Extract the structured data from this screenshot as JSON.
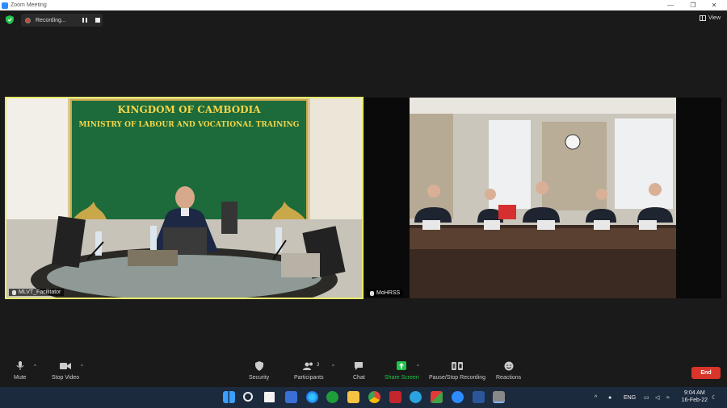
{
  "window": {
    "title": "Zoom Meeting",
    "controls": {
      "minimize": "—",
      "restore": "❐",
      "close": "✕"
    }
  },
  "meeting_bar": {
    "recording_label": "Recording...",
    "view_label": "View"
  },
  "participants_video": [
    {
      "name": "MLVT_Facilitator",
      "banner_line1": "KINGDOM OF CAMBODIA",
      "banner_line2": "MINISTRY OF LABOUR AND VOCATIONAL TRAINING",
      "active_speaker": true
    },
    {
      "name": "MoHRSS",
      "active_speaker": false
    }
  ],
  "toolbar": {
    "mute": "Mute",
    "stop_video": "Stop Video",
    "security": "Security",
    "participants": "Participants",
    "participants_count": "3",
    "chat": "Chat",
    "share_screen": "Share Screen",
    "record": "Pause/Stop Recording",
    "reactions": "Reactions",
    "end": "End"
  },
  "taskbar": {
    "language": "ENG",
    "time": "9:04 AM",
    "date": "16-Feb-22"
  },
  "colors": {
    "accent_green": "#22c34a",
    "end_red": "#d9352b",
    "active_border": "#e7e96b"
  }
}
